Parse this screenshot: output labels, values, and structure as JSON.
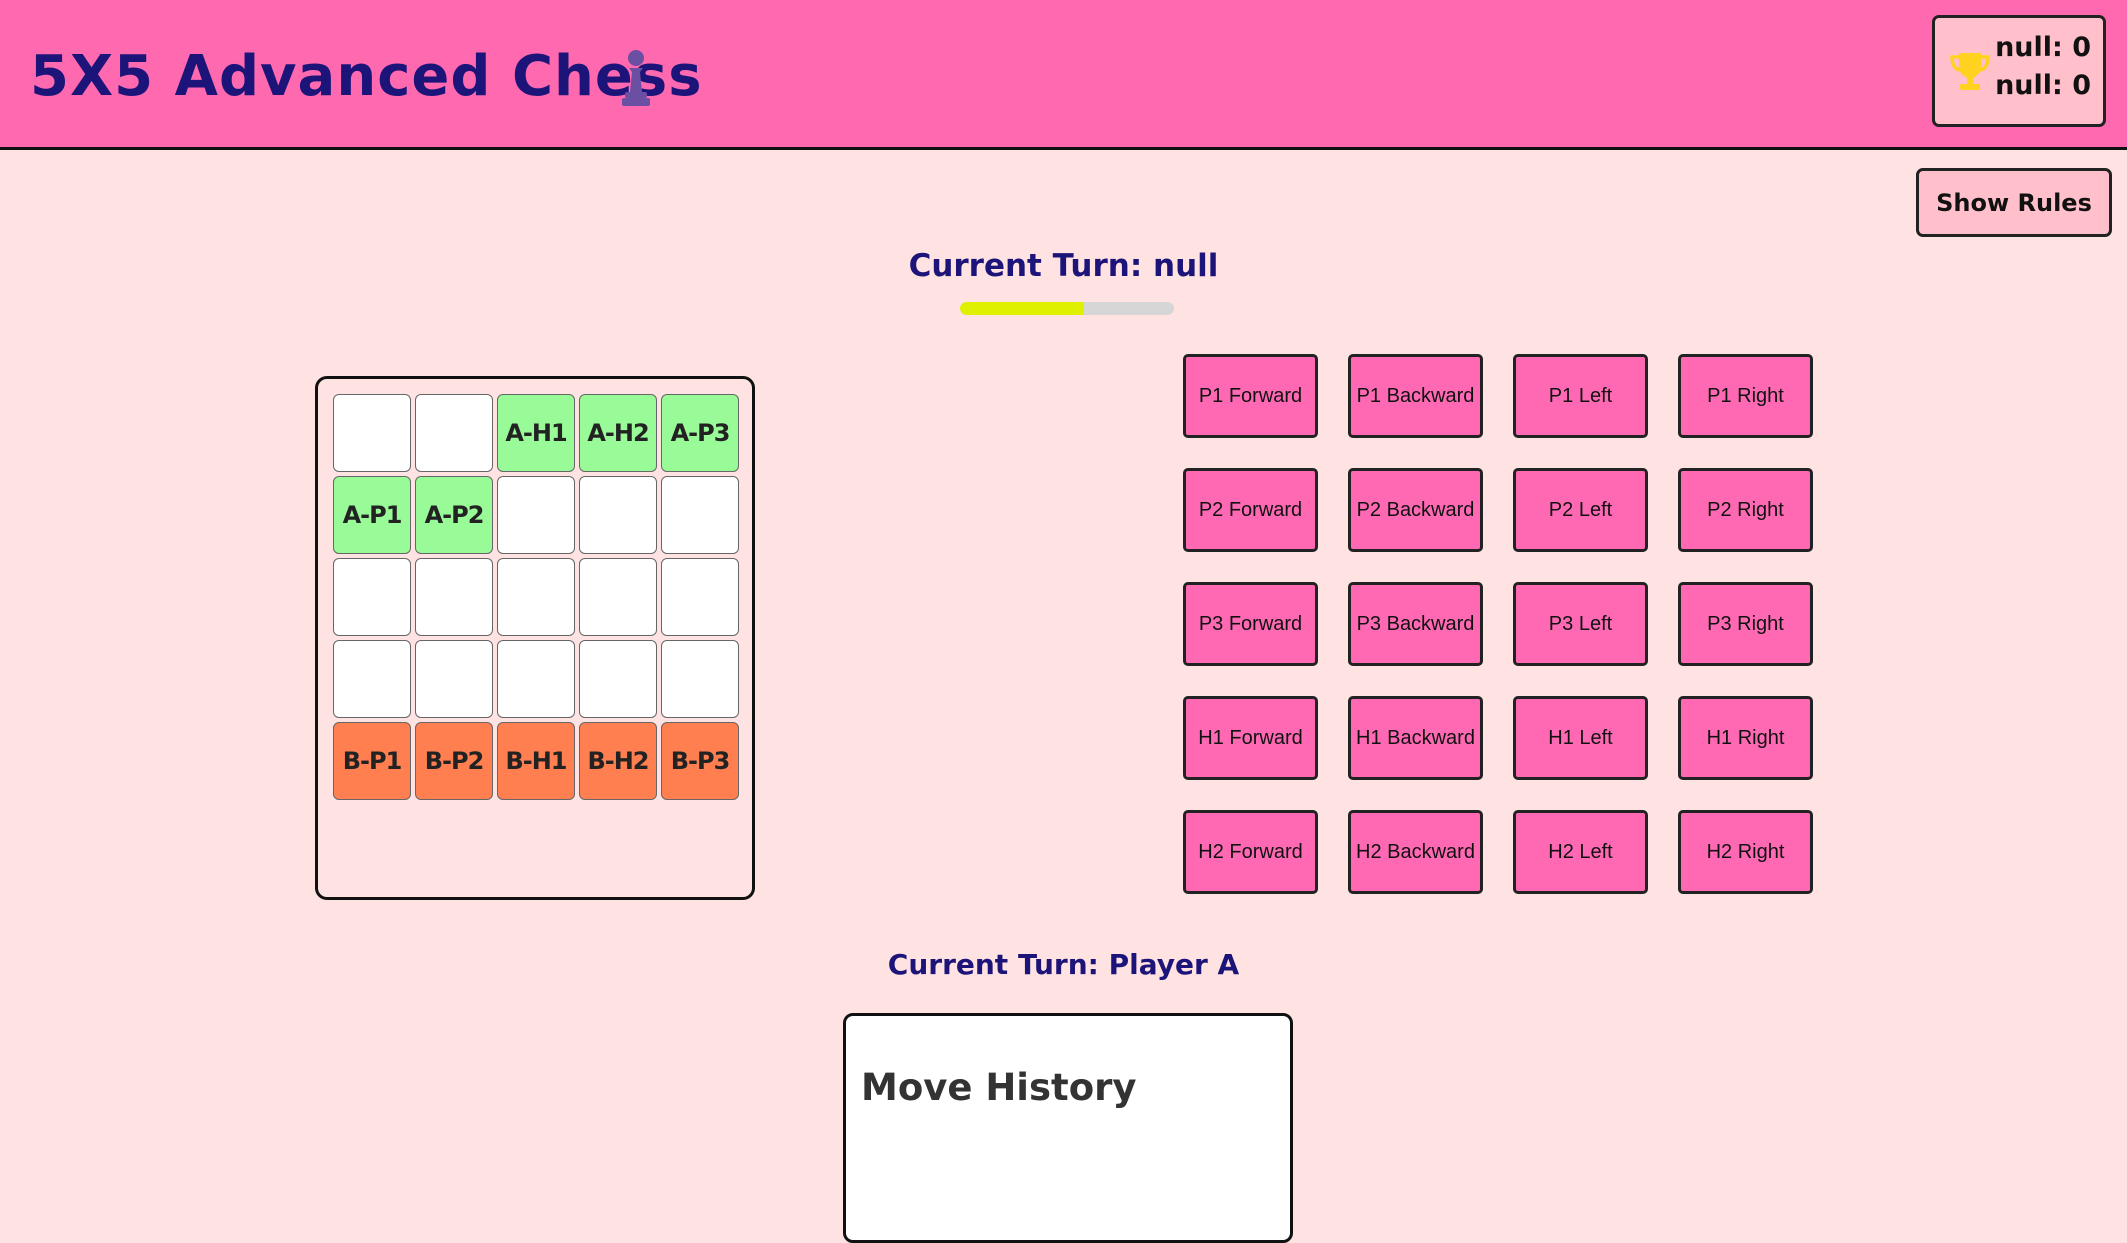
{
  "header": {
    "title": "5X5 Advanced Chess",
    "icon": "pawn-icon",
    "background_color": "#ff69b0",
    "title_color": "#1d147a"
  },
  "score": {
    "icon": "trophy-icon",
    "lines": [
      "null: 0",
      "null: 0"
    ]
  },
  "rules_button": {
    "label": "Show Rules"
  },
  "turn_status": {
    "top": "Current Turn: null",
    "bottom": "Current Turn: Player A"
  },
  "timer": {
    "fraction_remaining": 0.58,
    "fill_color": "#dff000",
    "track_color": "#d6d6d6"
  },
  "board": {
    "player_a_color": "#98fb98",
    "player_b_color": "#ff7f50",
    "rows": [
      [
        "",
        "",
        "A-H1",
        "A-H2",
        "A-P3"
      ],
      [
        "A-P1",
        "A-P2",
        "",
        "",
        ""
      ],
      [
        "",
        "",
        "",
        "",
        ""
      ],
      [
        "",
        "",
        "",
        "",
        ""
      ],
      [
        "B-P1",
        "B-P2",
        "B-H1",
        "B-H2",
        "B-P3"
      ]
    ]
  },
  "moves": {
    "button_color": "#ff69b4",
    "buttons": [
      "P1 Forward",
      "P1 Backward",
      "P1 Left",
      "P1 Right",
      "P2 Forward",
      "P2 Backward",
      "P2 Left",
      "P2 Right",
      "P3 Forward",
      "P3 Backward",
      "P3 Left",
      "P3 Right",
      "H1 Forward",
      "H1 Backward",
      "H1 Left",
      "H1 Right",
      "H2 Forward",
      "H2 Backward",
      "H2 Left",
      "H2 Right"
    ]
  },
  "history": {
    "title": "Move History",
    "entries": []
  }
}
